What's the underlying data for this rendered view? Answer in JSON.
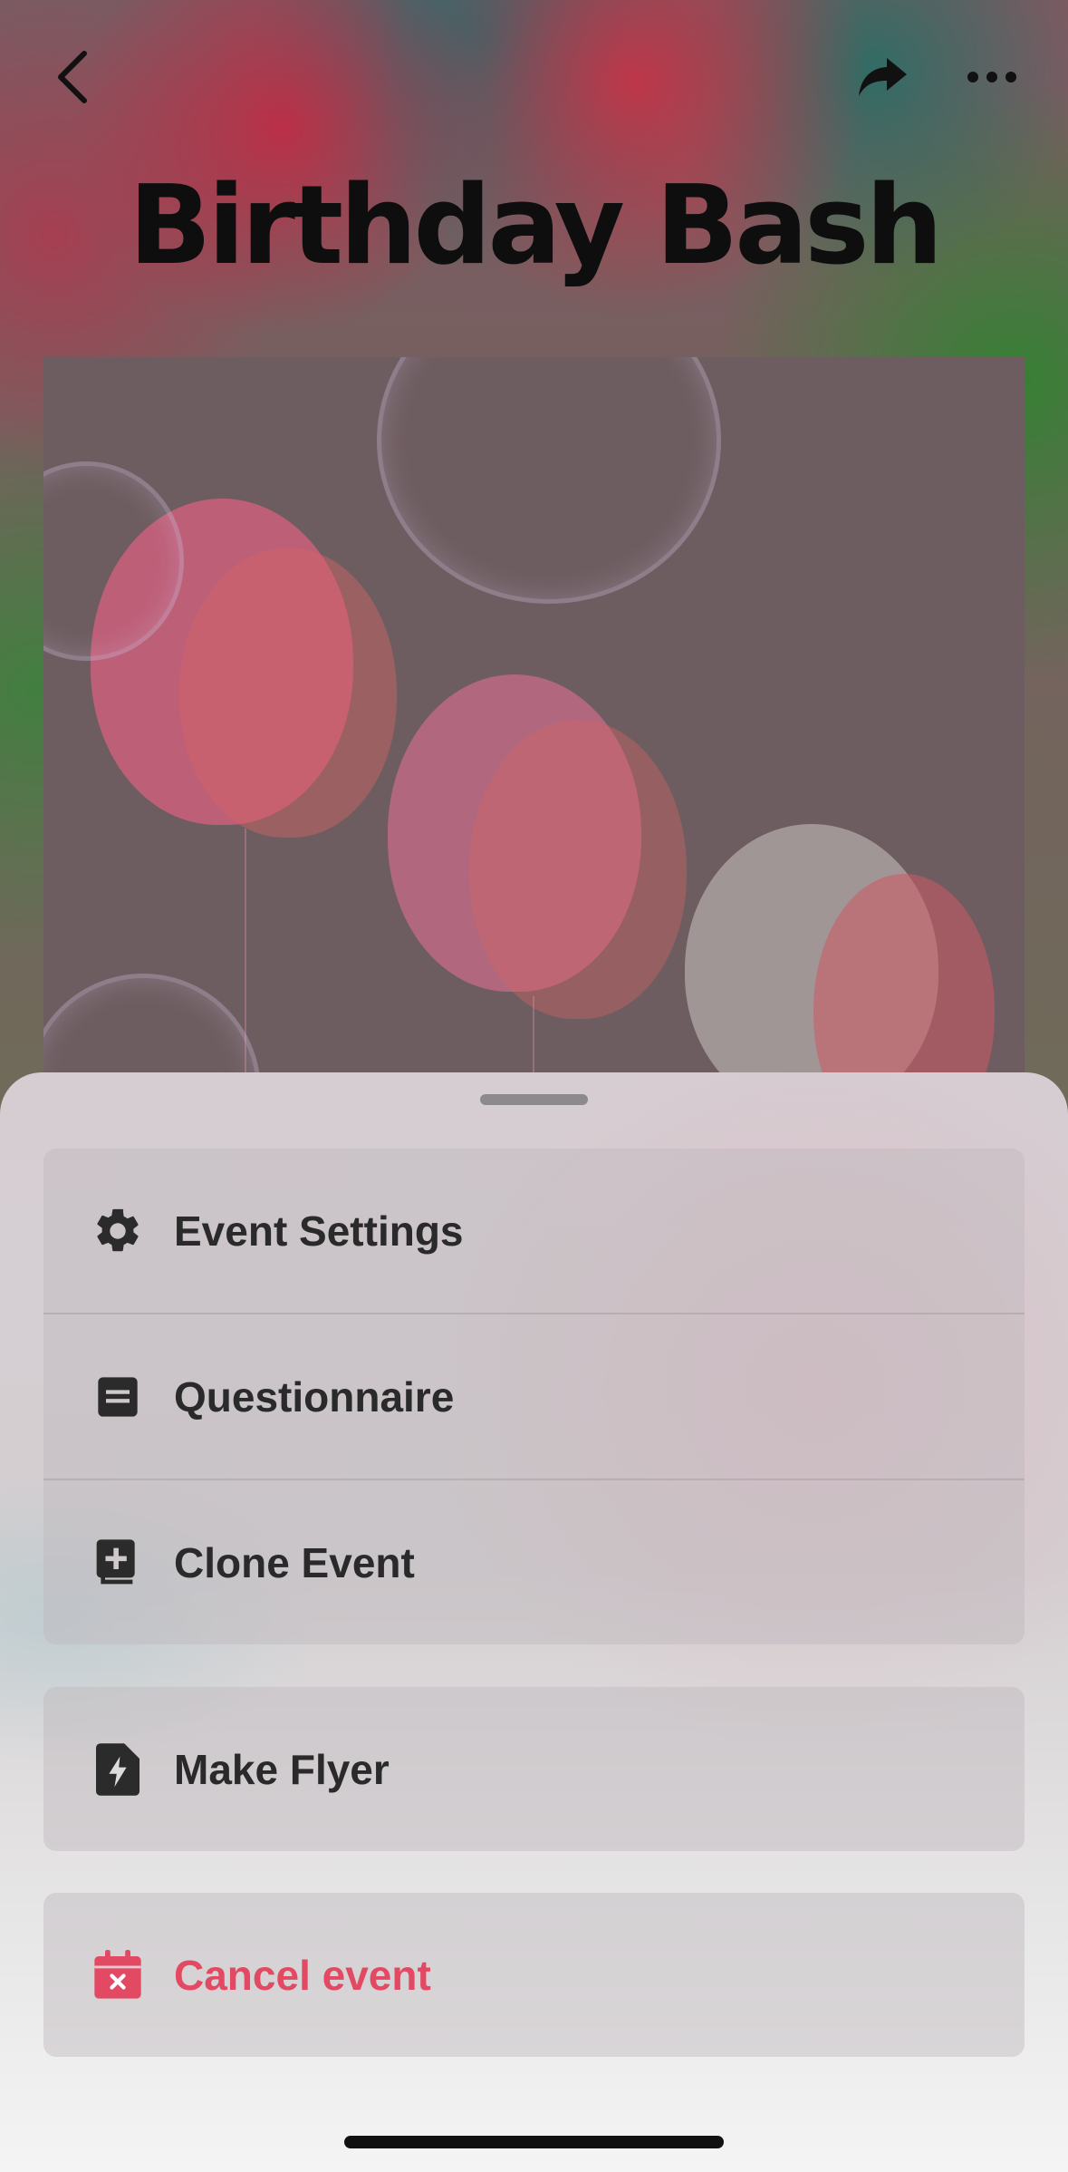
{
  "event": {
    "title": "Birthday Bash"
  },
  "nav": {
    "back_icon": "chevron-left-icon",
    "share_icon": "share-arrow-icon",
    "more_icon": "ellipsis-icon"
  },
  "sheet": {
    "group1": [
      {
        "label": "Event Settings",
        "icon": "gear-icon"
      },
      {
        "label": "Questionnaire",
        "icon": "document-icon"
      },
      {
        "label": "Clone Event",
        "icon": "clone-plus-icon"
      }
    ],
    "flyer": {
      "label": "Make Flyer",
      "icon": "file-bolt-icon"
    },
    "cancel": {
      "label": "Cancel event",
      "icon": "calendar-x-icon",
      "color": "#e24a63"
    }
  }
}
